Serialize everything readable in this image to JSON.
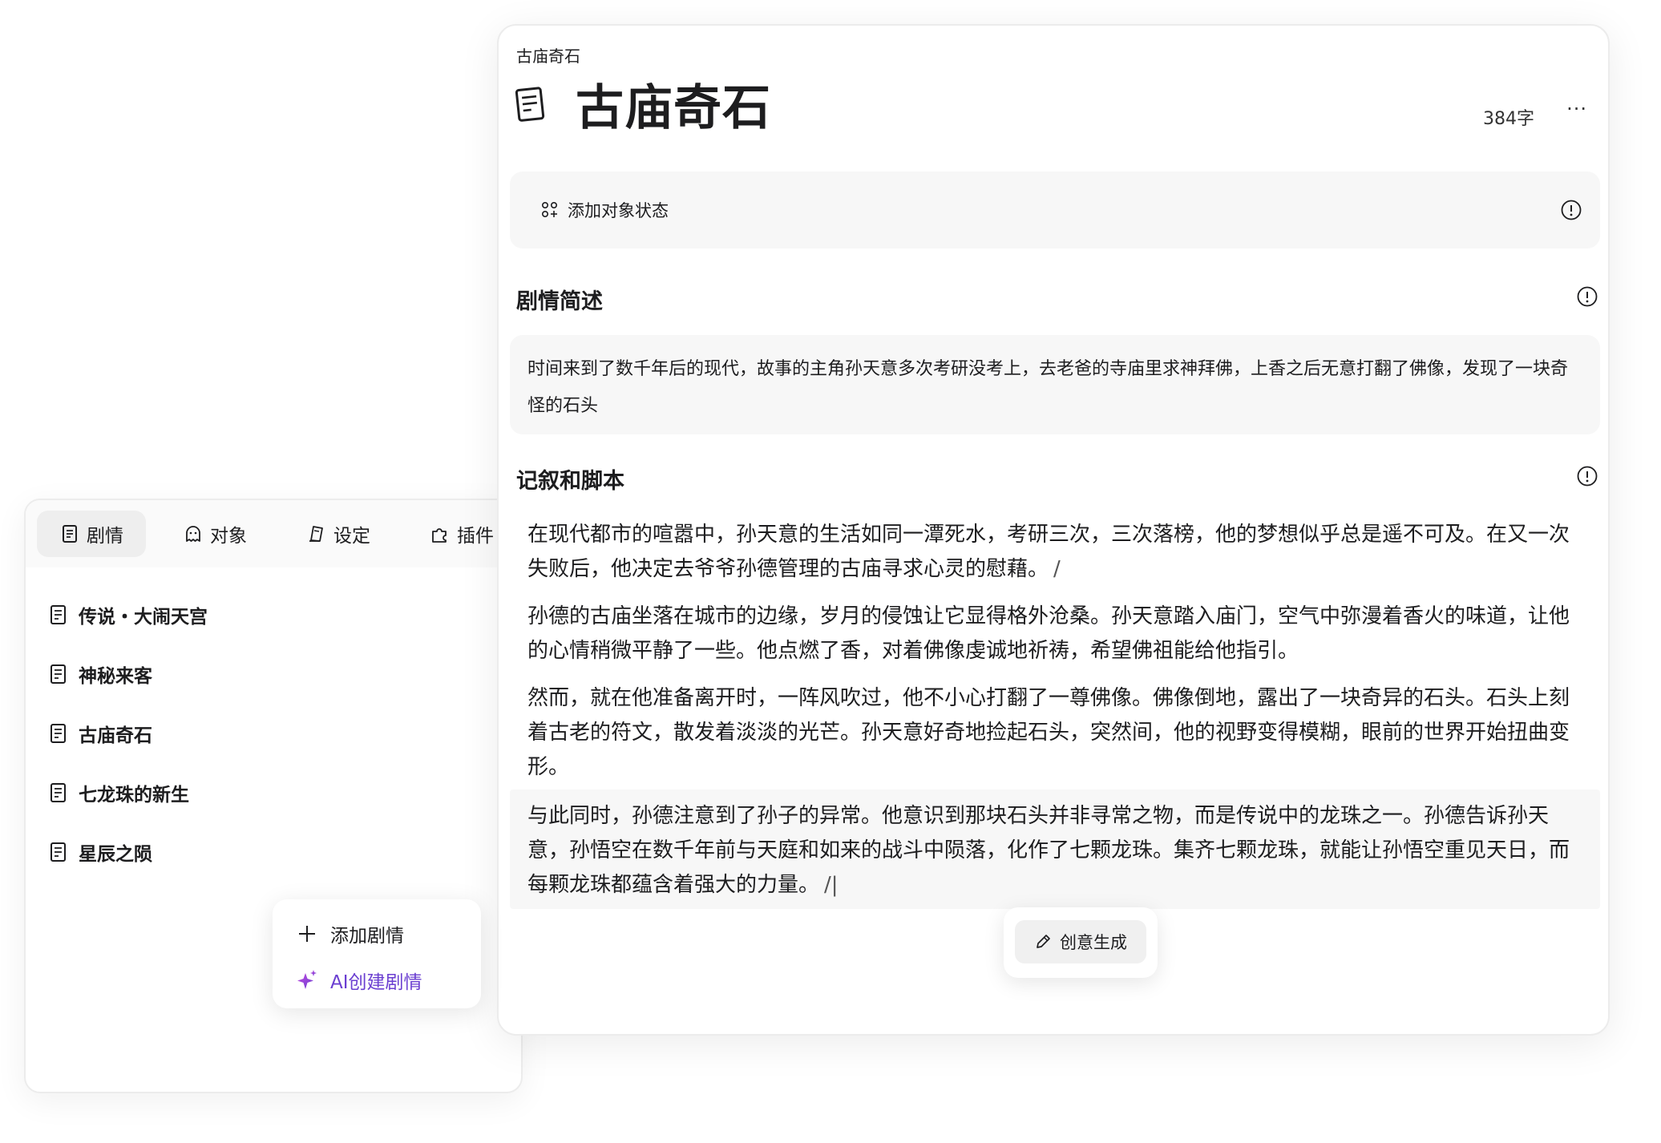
{
  "sidebar": {
    "tabs": [
      {
        "label": "剧情",
        "icon": "doc-icon",
        "active": true
      },
      {
        "label": "对象",
        "icon": "ghost-icon",
        "active": false
      },
      {
        "label": "设定",
        "icon": "book-icon",
        "active": false
      },
      {
        "label": "插件",
        "icon": "puzzle-icon",
        "active": false
      }
    ],
    "stories": [
      {
        "label": "传说・大闹天宫"
      },
      {
        "label": "神秘来客"
      },
      {
        "label": "古庙奇石"
      },
      {
        "label": "七龙珠的新生"
      },
      {
        "label": "星辰之陨"
      }
    ]
  },
  "add_menu": {
    "add_label": "添加剧情",
    "ai_label": "AI创建剧情",
    "ai_color": "#6b3fd1"
  },
  "document": {
    "breadcrumb": "古庙奇石",
    "title": "古庙奇石",
    "word_count": "384字",
    "more": "···",
    "add_state_label": "添加对象状态",
    "summary_heading": "剧情简述",
    "summary_text": "时间来到了数千年后的现代，故事的主角孙天意多次考研没考上，去老爸的寺庙里求神拜佛，上香之后无意打翻了佛像，发现了一块奇怪的石头",
    "script_heading": "记叙和脚本",
    "paragraphs": [
      {
        "text": "在现代都市的喧嚣中，孙天意的生活如同一潭死水，考研三次，三次落榜，他的梦想似乎总是遥不可及。在又一次失败后，他决定去爷爷孙德管理的古庙寻求心灵的慰藉。",
        "marker": "/"
      },
      {
        "text": "孙德的古庙坐落在城市的边缘，岁月的侵蚀让它显得格外沧桑。孙天意踏入庙门，空气中弥漫着香火的味道，让他的心情稍微平静了一些。他点燃了香，对着佛像虔诚地祈祷，希望佛祖能给他指引。",
        "marker": ""
      },
      {
        "text": "然而，就在他准备离开时，一阵风吹过，他不小心打翻了一尊佛像。佛像倒地，露出了一块奇异的石头。石头上刻着古老的符文，散发着淡淡的光芒。孙天意好奇地捡起石头，突然间，他的视野变得模糊，眼前的世界开始扭曲变形。",
        "marker": ""
      },
      {
        "text": "与此同时，孙德注意到了孙子的异常。他意识到那块石头并非寻常之物，而是传说中的龙珠之一。孙德告诉孙天意，孙悟空在数千年前与天庭和如来的战斗中陨落，化作了七颗龙珠。集齐七颗龙珠，就能让孙悟空重见天日，而每颗龙珠都蕴含着强大的力量。",
        "marker": "/|"
      }
    ],
    "generate_label": "创意生成"
  }
}
